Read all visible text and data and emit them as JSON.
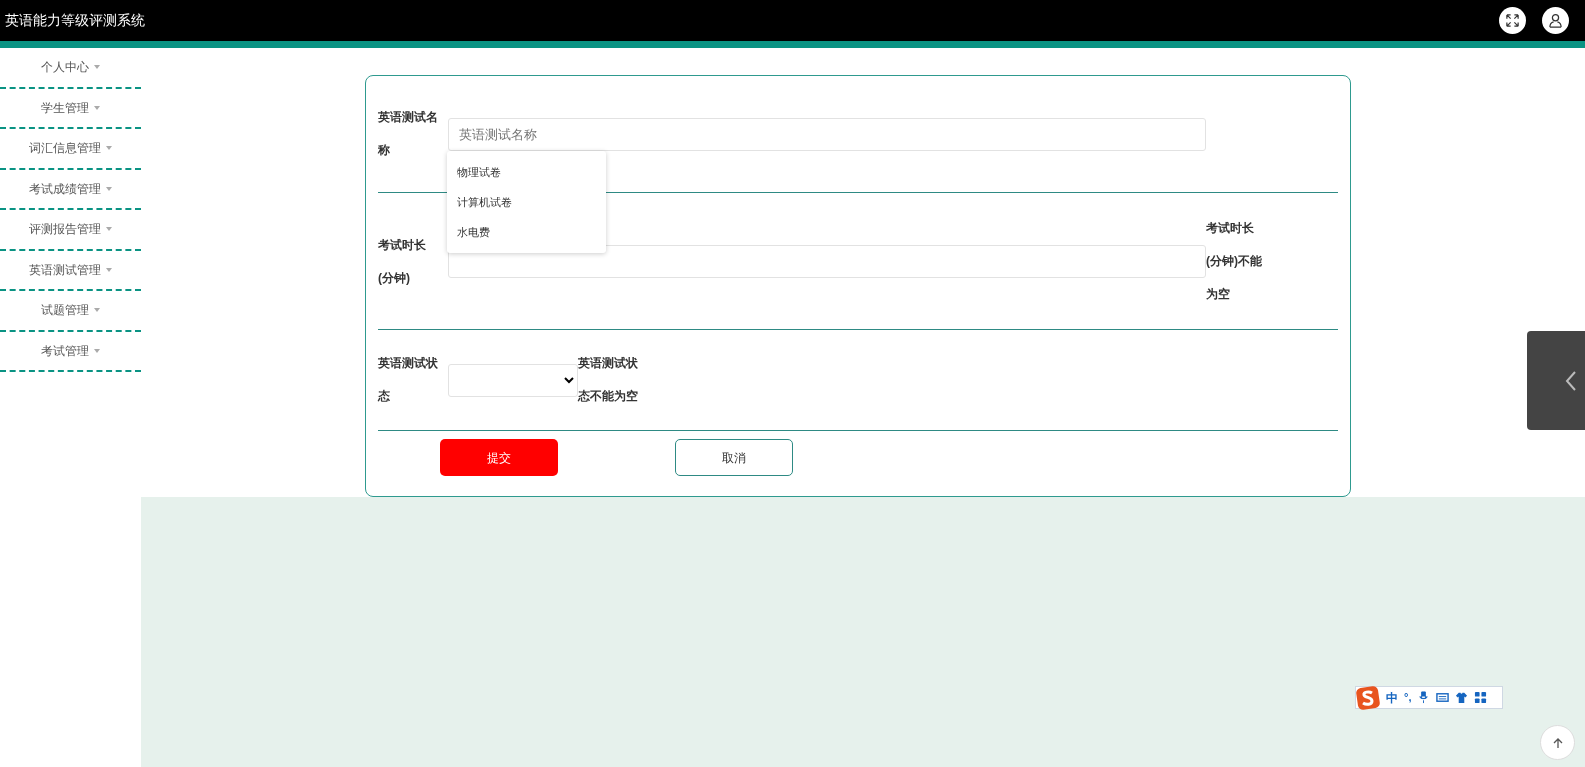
{
  "header": {
    "title": "英语能力等级评测系统"
  },
  "sidebar": {
    "items": [
      {
        "label": "个人中心"
      },
      {
        "label": "学生管理"
      },
      {
        "label": "词汇信息管理"
      },
      {
        "label": "考试成绩管理"
      },
      {
        "label": "评测报告管理"
      },
      {
        "label": "英语测试管理"
      },
      {
        "label": "试题管理"
      },
      {
        "label": "考试管理"
      }
    ]
  },
  "form": {
    "fields": [
      {
        "kind": "text",
        "label": "英语测试名称",
        "placeholder": "英语测试名称",
        "suggestions": [
          "物理试卷",
          "计算机试卷",
          "水电费"
        ]
      },
      {
        "kind": "text",
        "label": "考试时长(分钟)",
        "error": "考试时长(分钟)不能为空"
      },
      {
        "kind": "select",
        "label": "英语测试状态",
        "error": "英语测试状态不能为空"
      }
    ],
    "buttons": [
      {
        "kind": "primary",
        "label": "提交"
      },
      {
        "kind": "outline",
        "label": "取消"
      }
    ]
  },
  "ime_toolbar": {
    "mode": "中",
    "punctuation": "°,"
  }
}
